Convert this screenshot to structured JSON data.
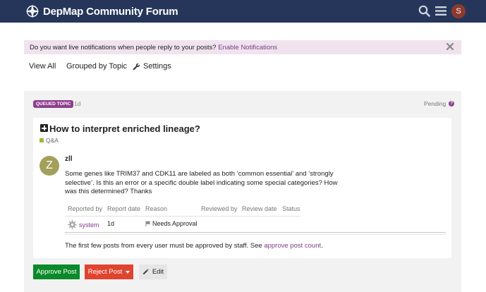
{
  "header": {
    "site_name": "DepMap Community Forum",
    "avatar_letter": "S",
    "avatar_color": "#8d3a2e",
    "bg_color": "#26365a",
    "icons": [
      "compass-logo-icon",
      "search-icon",
      "hamburger-menu-icon"
    ]
  },
  "notice": {
    "text": "Do you want live notifications when people reply to your posts?",
    "link": "Enable Notifications",
    "close_icon": "close-icon"
  },
  "nav": {
    "view_all": "View All",
    "grouped": "Grouped by Topic",
    "settings": "Settings"
  },
  "queued": {
    "badge": "QUEUED TOPIC",
    "age": "1d",
    "status": "Pending",
    "help": "?",
    "accent": "#8e3f8f"
  },
  "topic": {
    "title": "How to interpret enriched lineage?",
    "category": "Q&A",
    "category_color": "#9eb83b"
  },
  "post": {
    "avatar_letter": "Z",
    "username": "zll",
    "body": "Some genes like TRIM37 and CDK11 are labeled as both ‘common essential’ and ‘strongly selective’. Is this an error or a specific double label indicating some special categories? How was this determined? Thanks"
  },
  "review_table": {
    "headers": [
      "Reported by",
      "Report date",
      "Reason",
      "Reviewed by",
      "Review date",
      "Status"
    ],
    "row": {
      "reported_by": "system",
      "report_date": "1d",
      "reason": "Needs Approval",
      "reviewed_by": "",
      "review_date": "",
      "status": ""
    }
  },
  "footer": {
    "text": "The first few posts from every user must be approved by staff. See",
    "link": "approve post count",
    "end": "."
  },
  "actions": {
    "approve": "Approve Post",
    "reject": "Reject Post",
    "edit": "Edit",
    "approve_color": "#0a8a2a",
    "reject_color": "#e0442f"
  }
}
